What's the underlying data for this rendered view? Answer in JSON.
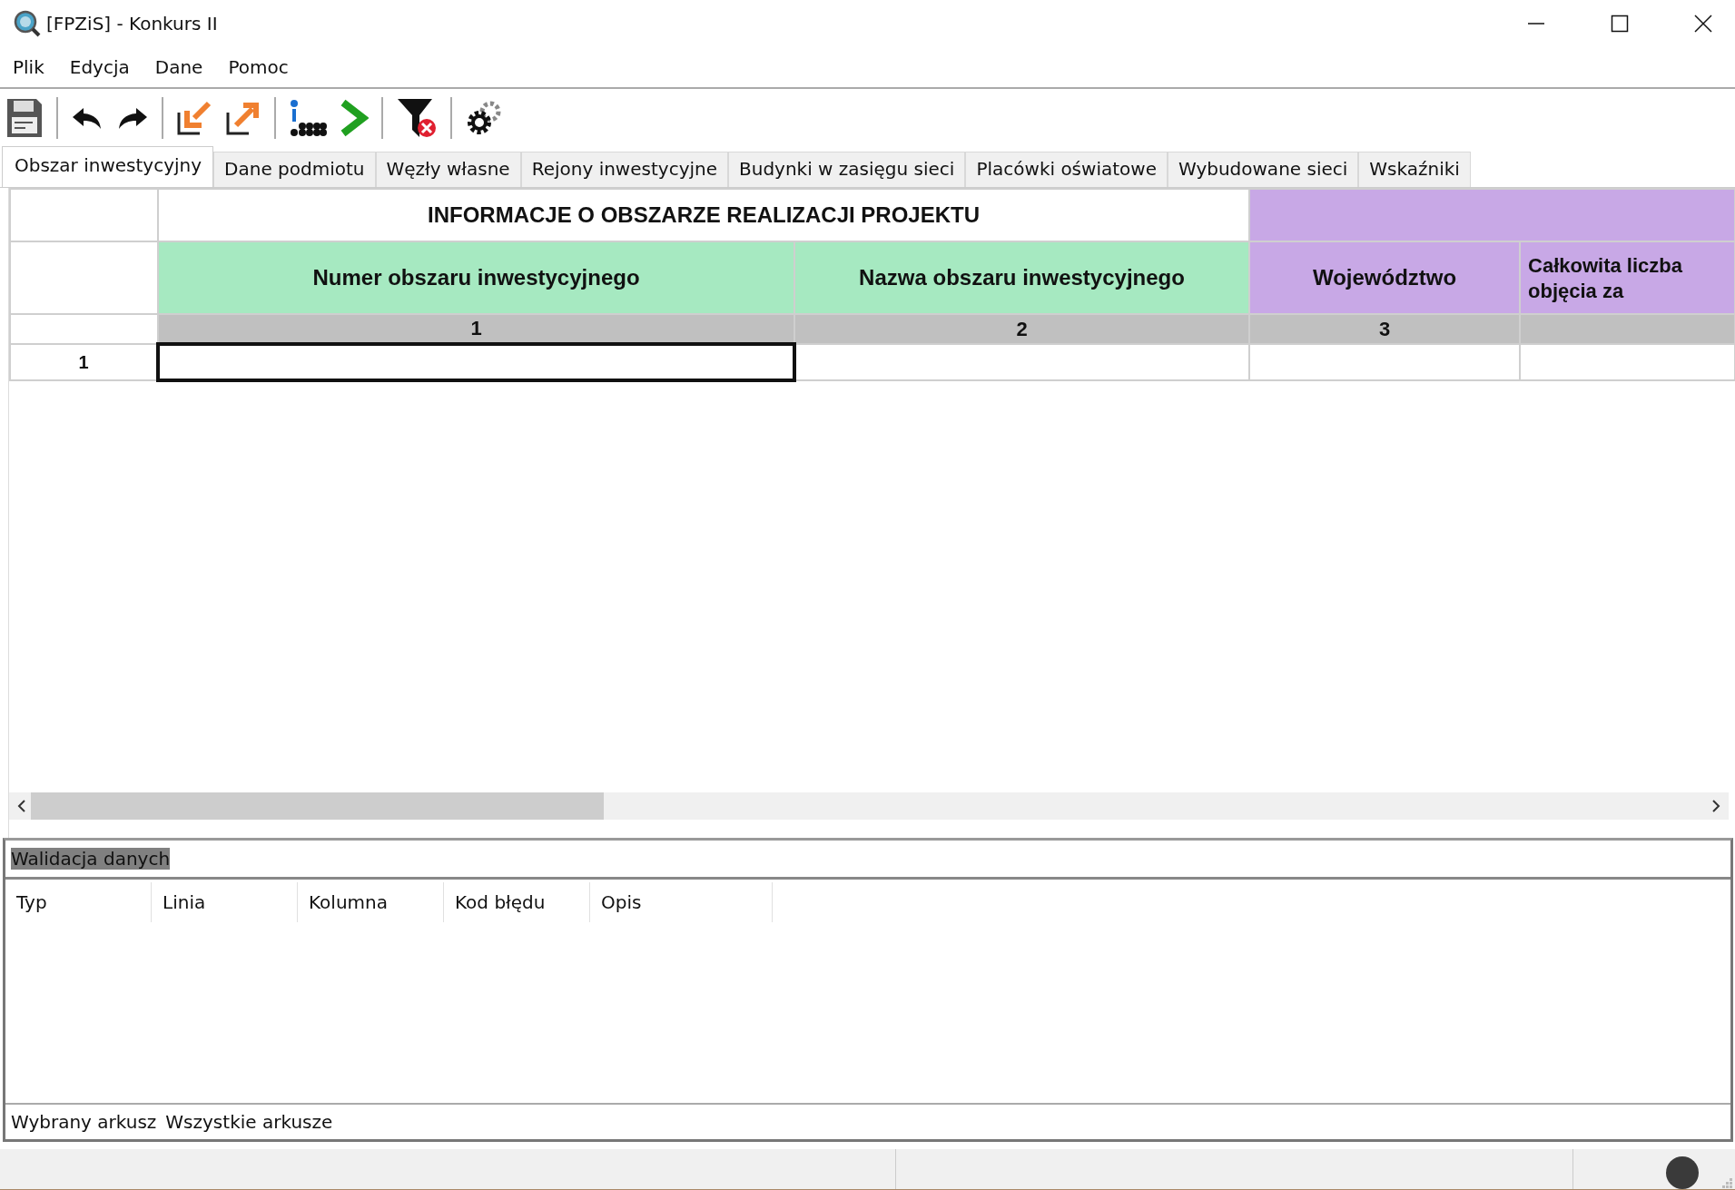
{
  "window": {
    "title": "[FPZiS] - Konkurs II"
  },
  "menu": [
    "Plik",
    "Edycja",
    "Dane",
    "Pomoc"
  ],
  "tabs": [
    {
      "label": "Obszar inwestycyjny",
      "selected": true
    },
    {
      "label": "Dane podmiotu",
      "selected": false
    },
    {
      "label": "Węzły własne",
      "selected": false
    },
    {
      "label": "Rejony inwestycyjne",
      "selected": false
    },
    {
      "label": "Budynki w zasięgu sieci",
      "selected": false
    },
    {
      "label": "Placówki oświatowe",
      "selected": false
    },
    {
      "label": "Wybudowane sieci",
      "selected": false
    },
    {
      "label": "Wskaźniki",
      "selected": false
    }
  ],
  "grid": {
    "group_headers": [
      {
        "label": "INFORMACJE O OBSZARZE REALIZACJI PROJEKTU",
        "color": "#ffffff"
      },
      {
        "color": "#c8a8e6"
      }
    ],
    "columns": [
      {
        "label": "Numer obszaru inwestycyjnego",
        "color": "#a6e9c1",
        "number": "1"
      },
      {
        "label": "Nazwa obszaru inwestycyjnego",
        "color": "#a6e9c1",
        "number": "2"
      },
      {
        "label": "Województwo",
        "color": "#c8a8e6",
        "number": "3"
      },
      {
        "label": "Całkowita liczba\nobjęcia za",
        "color": "#c8a8e6"
      }
    ],
    "rows": [
      {
        "label": "1",
        "cells": [
          {
            "selected": true
          },
          {
            "selected": false
          },
          {
            "selected": false
          },
          {
            "selected": false
          }
        ]
      }
    ]
  },
  "validation": {
    "title": "Walidacja danych",
    "columns": [
      "Typ",
      "Linia",
      "Kolumna",
      "Kod błędu",
      "Opis"
    ],
    "footer_tabs": [
      "Wybrany arkusz",
      "Wszystkie arkusze"
    ]
  }
}
